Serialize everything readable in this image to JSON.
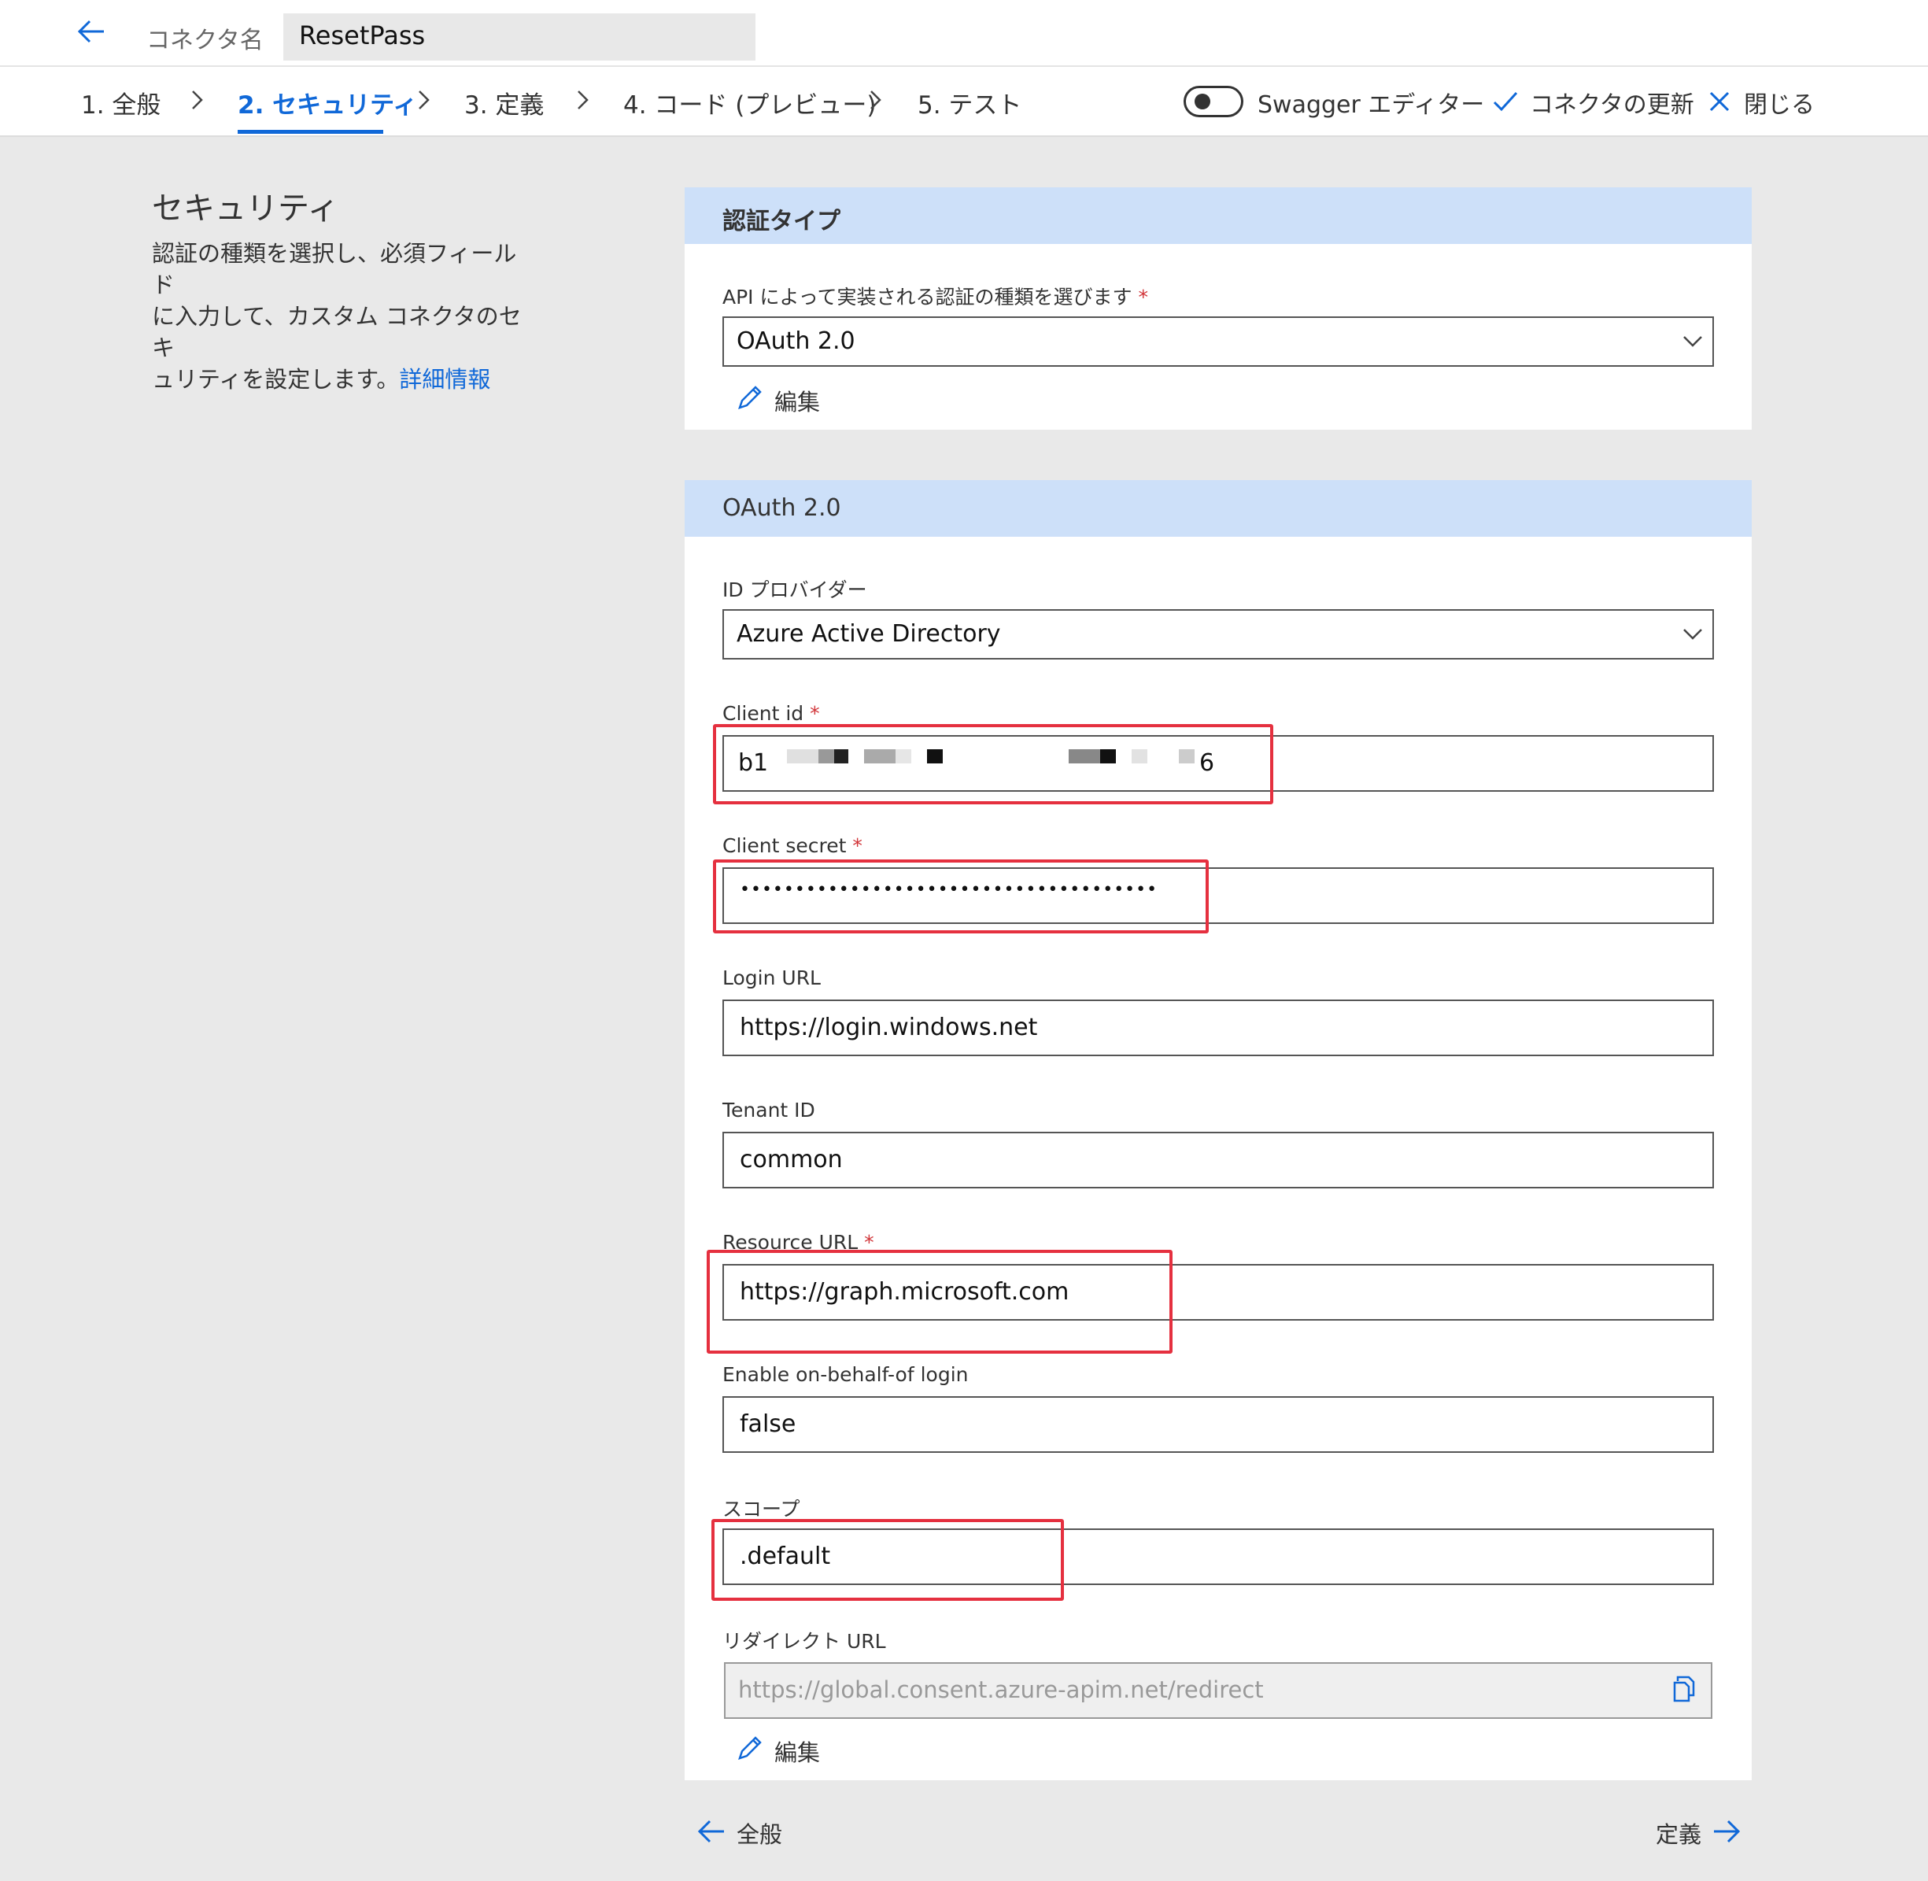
{
  "header": {
    "connector_label": "コネクタ名",
    "connector_name": "ResetPass"
  },
  "steps": [
    {
      "label": "1. 全般"
    },
    {
      "label": "2. セキュリティ"
    },
    {
      "label": "3. 定義"
    },
    {
      "label": "4. コード (プレビュー)"
    },
    {
      "label": "5. テスト"
    }
  ],
  "toolbar": {
    "swagger_label": "Swagger エディター",
    "update_label": "コネクタの更新",
    "close_label": "閉じる"
  },
  "security": {
    "title": "セキュリティ",
    "desc_line1": "認証の種類を選択し、必須フィールド",
    "desc_line2": "に入力して、カスタム コネクタのセキ",
    "desc_line3": "ュリティを設定します。",
    "more_link": "詳細情報"
  },
  "auth_card": {
    "header": "認証タイプ",
    "label": "API によって実装される認証の種類を選びます",
    "value": "OAuth 2.0",
    "edit_label": "編集"
  },
  "oauth_card": {
    "header": "OAuth 2.0",
    "provider_label": "ID プロバイダー",
    "provider_value": "Azure Active Directory",
    "client_id_label": "Client id",
    "client_id_prefix": "b1",
    "client_id_suffix": "6",
    "client_secret_label": "Client secret",
    "client_secret_value": "••••••••••••••••••••••••••••••••••••••",
    "login_url_label": "Login URL",
    "login_url_value": "https://login.windows.net",
    "tenant_label": "Tenant ID",
    "tenant_value": "common",
    "resource_label": "Resource URL",
    "resource_value": "https://graph.microsoft.com",
    "obo_label": "Enable on-behalf-of login",
    "obo_value": "false",
    "scope_label": "スコープ",
    "scope_value": ".default",
    "redirect_label": "リダイレクト URL",
    "redirect_value": "https://global.consent.azure-apim.net/redirect",
    "edit_label": "編集"
  },
  "footer_nav": {
    "prev_label": "全般",
    "next_label": "定義"
  },
  "colors": {
    "accent": "#1068d8",
    "card_header": "#cde0f9",
    "highlight": "#e5303f",
    "required": "#d13438"
  }
}
